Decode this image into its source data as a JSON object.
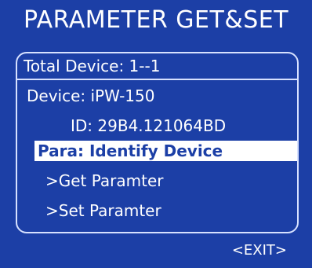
{
  "screen": {
    "title": "PARAMETER GET&SET",
    "total_device": "Total Device: 1--1",
    "device": "Device: iPW-150",
    "device_id": "ID: 29B4.121064BD",
    "para": "Para: Identify Device",
    "menu": [
      {
        "label": ">Get Paramter"
      },
      {
        "label": ">Set Paramter"
      }
    ],
    "exit_label": "<EXIT>"
  },
  "colors": {
    "background": "#1c3fa6",
    "text": "#ffffff",
    "highlight": "#ffffff",
    "highlight_text": "#1c3fa6",
    "border": "#d7e1ff"
  }
}
